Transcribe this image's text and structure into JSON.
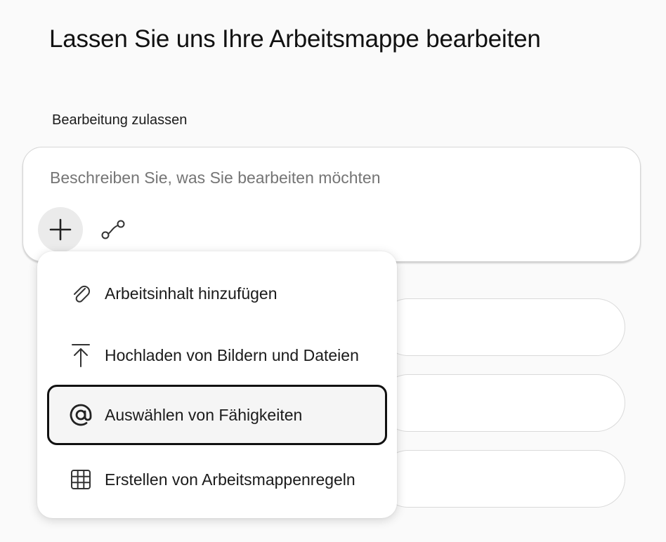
{
  "page": {
    "title": "Lassen Sie uns Ihre Arbeitsmappe bearbeiten",
    "section_label": "Bearbeitung zulassen"
  },
  "composer": {
    "placeholder": "Beschreiben Sie, was Sie bearbeiten möchten",
    "add_icon": "plus-icon",
    "connector_icon": "plug-icon"
  },
  "menu": {
    "items": [
      {
        "label": "Arbeitsinhalt hinzufügen",
        "icon": "paperclip-icon"
      },
      {
        "label": "Hochladen von Bildern und Dateien",
        "icon": "upload-icon"
      },
      {
        "label": "Auswählen von Fähigkeiten",
        "icon": "at-icon",
        "focused": true
      },
      {
        "label": "Erstellen von Arbeitsmappenregeln",
        "icon": "grid-icon"
      }
    ]
  },
  "colors": {
    "background": "#fafafa",
    "surface": "#ffffff",
    "focus_outline": "#111111",
    "plus_button": "#ebebeb"
  }
}
